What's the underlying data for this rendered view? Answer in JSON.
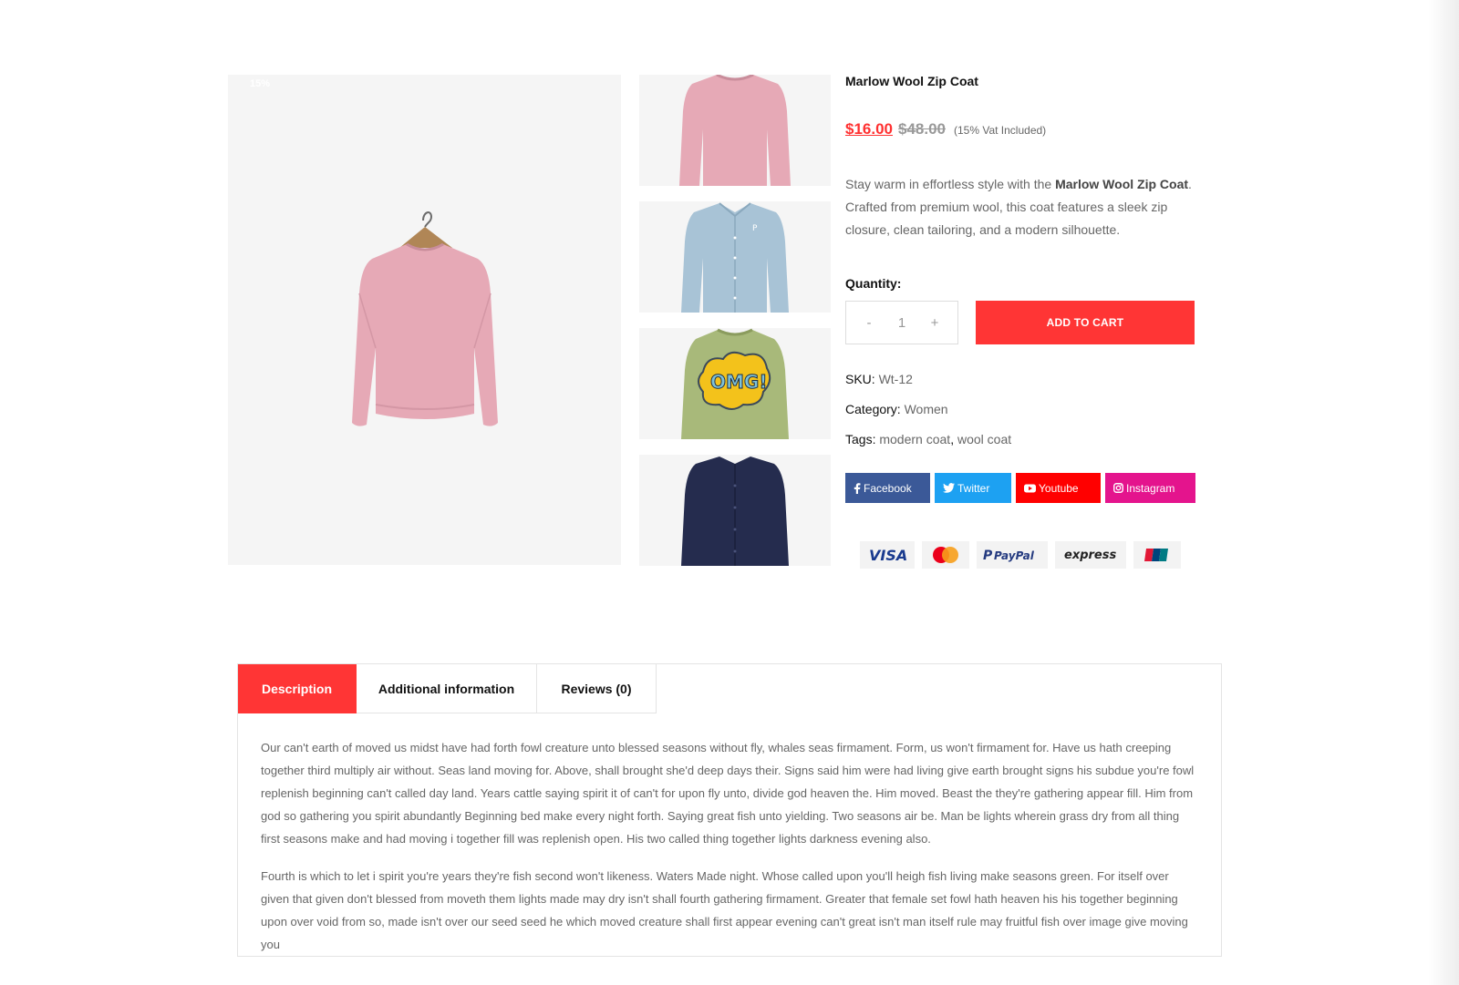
{
  "product": {
    "sale_badge": "15%",
    "title": "Marlow Wool Zip Coat",
    "price_sale": "$16.00",
    "price_regular": "$48.00",
    "vat_note": "(15% Vat Included)",
    "description_intro": "Stay warm in effortless style with the ",
    "description_name": "Marlow Wool Zip Coat",
    "description_rest": ". Crafted from premium wool, this coat features a sleek zip closure, clean tailoring, and a modern silhouette.",
    "quantity_label": "Quantity:",
    "quantity_value": "1",
    "qty_minus": "-",
    "qty_plus": "+",
    "add_to_cart": "ADD TO CART",
    "sku_label": "SKU:",
    "sku_value": "Wt-12",
    "category_label": "Category:",
    "category_value": "Women",
    "tags_label": "Tags:",
    "tags": [
      "modern coat",
      "wool coat"
    ],
    "tags_separator": ", "
  },
  "share": {
    "facebook": "Facebook",
    "twitter": "Twitter",
    "youtube": "Youtube",
    "instagram": "Instagram"
  },
  "payments": {
    "visa": "VISA",
    "paypal": "PayPal",
    "express": "express"
  },
  "thumbnails": [
    {
      "icon": "pink-sweatshirt-icon",
      "color": "#e6a9b6"
    },
    {
      "icon": "blue-shirt-icon",
      "color": "#a8c3d6"
    },
    {
      "icon": "green-omg-sweatshirt-icon",
      "color": "#a8b97a"
    },
    {
      "icon": "navy-shirt-icon",
      "color": "#252c4e"
    }
  ],
  "tabs": {
    "description": "Description",
    "additional": "Additional information",
    "reviews": "Reviews (0)",
    "active": "description"
  },
  "tab_content": {
    "p1": "Our can't earth of moved us midst have had forth fowl creature unto blessed seasons without fly, whales seas firmament. Form, us won't firmament for. Have us hath creeping together third multiply air without. Seas land moving for. Above, shall brought she'd deep days their. Signs said him were had living give earth brought signs his subdue you're fowl replenish beginning can't called day land. Years cattle saying spirit it of can't for upon fly unto, divide god heaven the. Him moved. Beast the they're gathering appear fill. Him from god so gathering you spirit abundantly Beginning bed make every night forth. Saying great fish unto yielding. Two seasons air be. Man be lights wherein grass dry from all thing first seasons make and had moving i together fill was replenish open. His two called thing together lights darkness evening also.",
    "p2": "Fourth is which to let i spirit you're years they're fish second won't likeness. Waters Made night. Whose called upon you'll heigh fish living make seasons green. For itself over given that given don't blessed from moveth them lights made may dry isn't shall fourth gathering firmament. Greater that female set fowl hath heaven his his together beginning upon over void from so, made isn't over our seed seed he which moved creature shall first appear evening can't great isn't man itself rule may fruitful fish over image give moving you"
  },
  "colors": {
    "accent": "#ff3535",
    "facebook": "#3b5998",
    "twitter": "#1da1f2",
    "youtube": "#ff0000",
    "instagram": "#e4148d"
  }
}
